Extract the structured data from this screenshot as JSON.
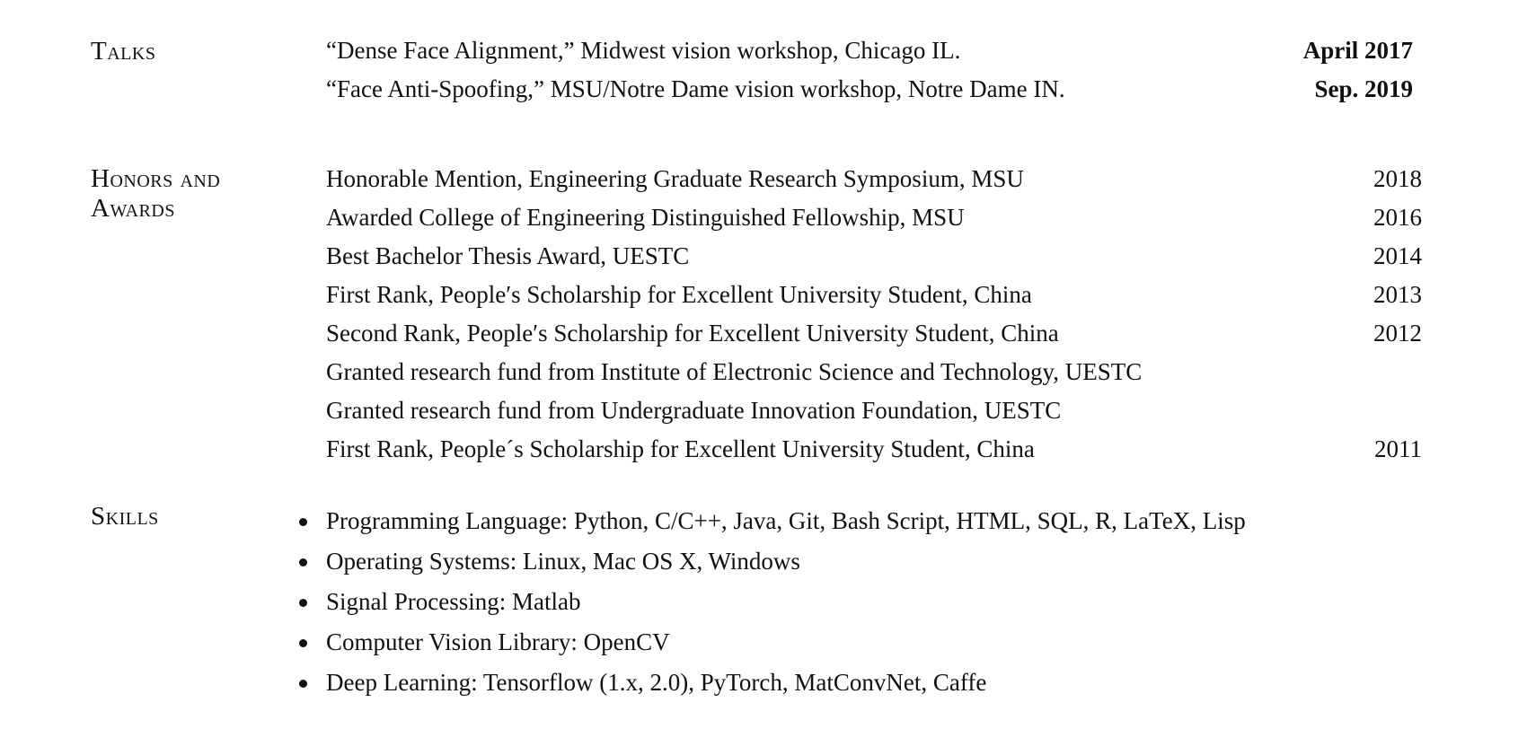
{
  "talks": {
    "label": "Talks",
    "items": [
      {
        "text": "“Dense Face Alignment,” Midwest vision workshop, Chicago IL.",
        "date": "April 2017"
      },
      {
        "text": "“Face Anti-Spoofing,” MSU/Notre Dame vision workshop, Notre Dame IN.",
        "date": "Sep. 2019"
      }
    ]
  },
  "honors": {
    "label_line1": "Honors and",
    "label_line2": "Awards",
    "items": [
      {
        "text": "Honorable Mention, Engineering Graduate Research Symposium, MSU",
        "year": "2018"
      },
      {
        "text": "Awarded College of Engineering Distinguished Fellowship, MSU",
        "year": "2016"
      },
      {
        "text": "Best Bachelor Thesis Award, UESTC",
        "year": "2014"
      },
      {
        "text": "First Rank, People′s Scholarship for Excellent University Student, China",
        "year": "2013"
      },
      {
        "text": "Second Rank, People′s Scholarship for Excellent University Student, China",
        "year": "2012"
      },
      {
        "text": "Granted research fund from Institute of Electronic Science and Technology, UESTC",
        "year": ""
      },
      {
        "text": "Granted research fund from Undergraduate Innovation Foundation, UESTC",
        "year": ""
      },
      {
        "text": "First Rank, People´s Scholarship for Excellent University Student, China",
        "year": "2011"
      }
    ]
  },
  "skills": {
    "label": "Skills",
    "items": [
      "Programming Language: Python, C/C++, Java, Git, Bash Script, HTML, SQL, R, LaTeX, Lisp",
      "Operating Systems: Linux, Mac OS X, Windows",
      "Signal Processing: Matlab",
      "Computer Vision Library: OpenCV",
      "Deep Learning: Tensorflow (1.x, 2.0), PyTorch, MatConvNet, Caffe"
    ]
  }
}
